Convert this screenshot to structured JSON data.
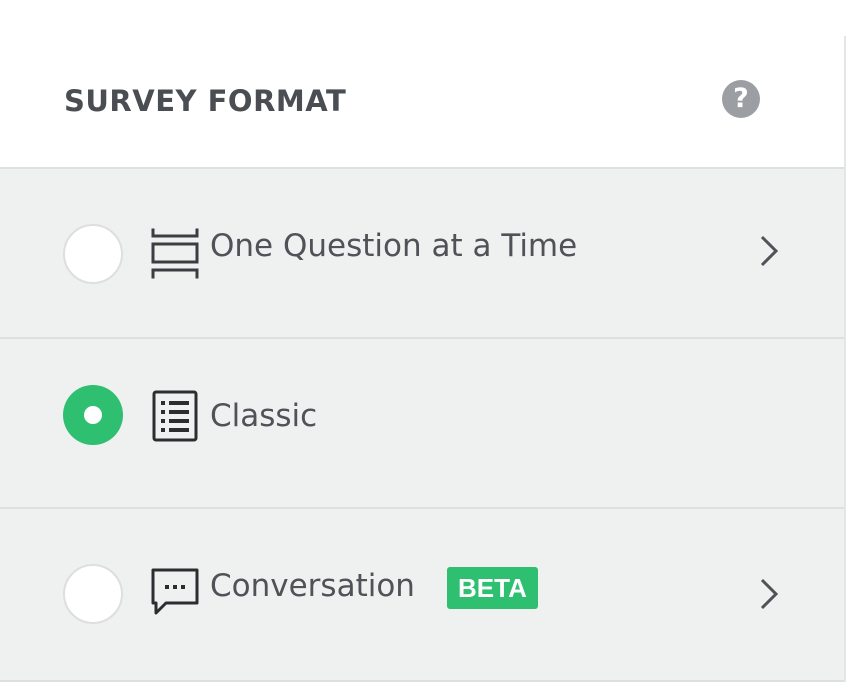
{
  "header": {
    "title": "SURVEY FORMAT",
    "help_glyph": "?"
  },
  "options": [
    {
      "label": "One Question at a Time",
      "icon": "one-question-icon",
      "selected": false,
      "has_chevron": true
    },
    {
      "label": "Classic",
      "icon": "classic-list-icon",
      "selected": true,
      "has_chevron": false
    },
    {
      "label": "Conversation",
      "icon": "conversation-icon",
      "badge": "BETA",
      "selected": false,
      "has_chevron": true
    }
  ],
  "colors": {
    "accent": "#2fbf71",
    "row_background": "#eff0f0",
    "text": "#4f5358",
    "header_text": "#4a4e52"
  }
}
